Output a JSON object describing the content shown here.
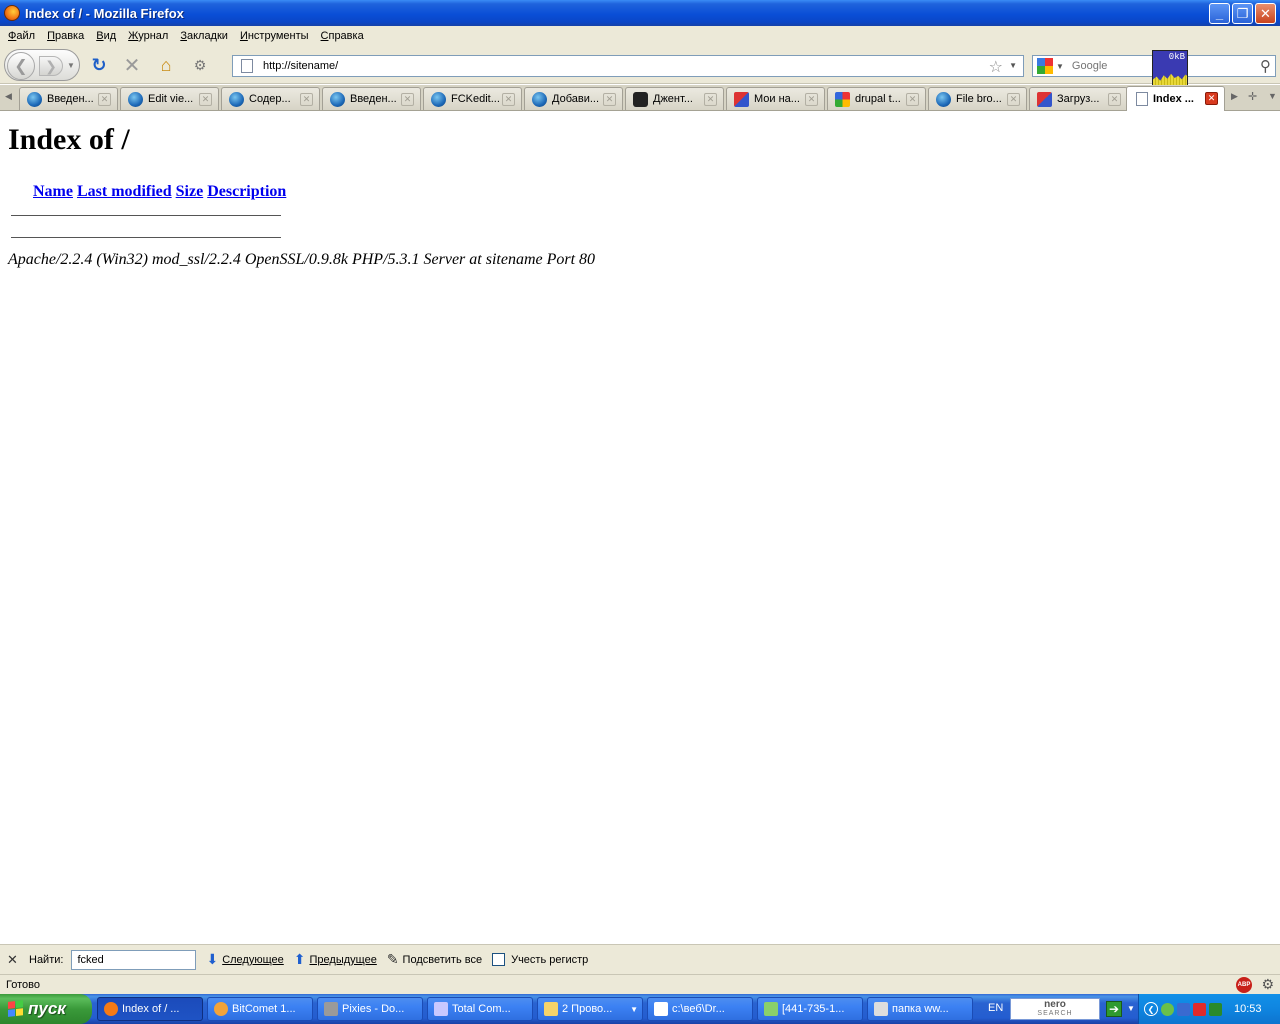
{
  "window": {
    "title": "Index of / - Mozilla Firefox",
    "buttons": {
      "minimize": "_",
      "maximize": "❐",
      "close": "✕"
    }
  },
  "menu": [
    "Файл",
    "Правка",
    "Вид",
    "Журнал",
    "Закладки",
    "Инструменты",
    "Справка"
  ],
  "nav": {
    "url": "http://sitename/",
    "search_placeholder": "Google",
    "net_rate": "0kB"
  },
  "tabs": [
    {
      "label": "Введен...",
      "icon": "drupal-icon"
    },
    {
      "label": "Edit vie...",
      "icon": "drupal-icon"
    },
    {
      "label": "Содер...",
      "icon": "drupal-icon"
    },
    {
      "label": "Введен...",
      "icon": "drupal-icon"
    },
    {
      "label": "FCKedit...",
      "icon": "drupal-icon"
    },
    {
      "label": "Добави...",
      "icon": "drupal-icon"
    },
    {
      "label": "Джент...",
      "icon": "ninja-icon"
    },
    {
      "label": "Мои на...",
      "icon": "mail-icon"
    },
    {
      "label": "drupal t...",
      "icon": "google-icon"
    },
    {
      "label": "File bro...",
      "icon": "drupal-icon"
    },
    {
      "label": "Загруз...",
      "icon": "mail-icon"
    },
    {
      "label": "Index ...",
      "icon": "page-icon",
      "active": true
    }
  ],
  "page": {
    "heading": "Index of /",
    "columns": [
      "Name",
      "Last modified",
      "Size",
      "Description"
    ],
    "address": "Apache/2.2.4 (Win32) mod_ssl/2.2.4 OpenSSL/0.9.8k PHP/5.3.1 Server at sitename Port 80"
  },
  "findbar": {
    "close": "✕",
    "label": "Найти:",
    "value": "fcked",
    "next": "Следующее",
    "prev": "Предыдущее",
    "highlight": "Подсветить все",
    "match_case": "Учесть регистр"
  },
  "status": {
    "text": "Готово",
    "abp": "ABP"
  },
  "taskbar": {
    "start": "пуск",
    "items": [
      {
        "label": "Index of / ...",
        "active": true,
        "color": "#f57a16"
      },
      {
        "label": "BitComet 1...",
        "color": "#f2a33a"
      },
      {
        "label": "Pixies - Do...",
        "color": "#9a9a9a"
      },
      {
        "label": "Total Com...",
        "color": "#c8c8ff"
      },
      {
        "label": "2 Прово...",
        "color": "#f5d36a",
        "grouped": true
      },
      {
        "label": "c:\\веб\\Dr...",
        "color": "#ffffff"
      },
      {
        "label": "[441-735-1...",
        "color": "#8ad06a"
      },
      {
        "label": "папка ww...",
        "color": "#dddddd"
      }
    ],
    "lang": "EN",
    "nero_top": "nero",
    "nero_bottom": "SEARCH",
    "clock": "10:53"
  }
}
